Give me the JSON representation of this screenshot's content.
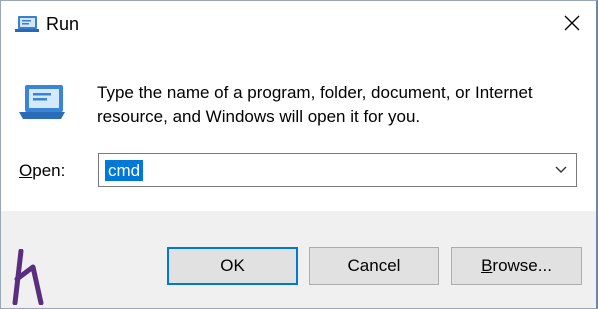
{
  "window": {
    "title": "Run",
    "title_icon": "run-dialog-icon",
    "close_icon": "close-icon"
  },
  "content": {
    "description_line1": "Type the name of a program, folder, document, or Internet",
    "description_line2": "resource, and Windows will open it for you.",
    "big_icon": "run-dialog-icon"
  },
  "open_field": {
    "label_access_key": "O",
    "label_rest": "pen:",
    "value": "cmd",
    "dropdown_icon": "chevron-down-icon"
  },
  "buttons": {
    "ok_label": "OK",
    "cancel_label": "Cancel",
    "browse_access_key": "B",
    "browse_rest": "rowse..."
  },
  "colors": {
    "selection": "#0078d7",
    "footer_bg": "#f0f0f0",
    "button_bg": "#e1e1e1",
    "logo": "#5b2d7e"
  }
}
